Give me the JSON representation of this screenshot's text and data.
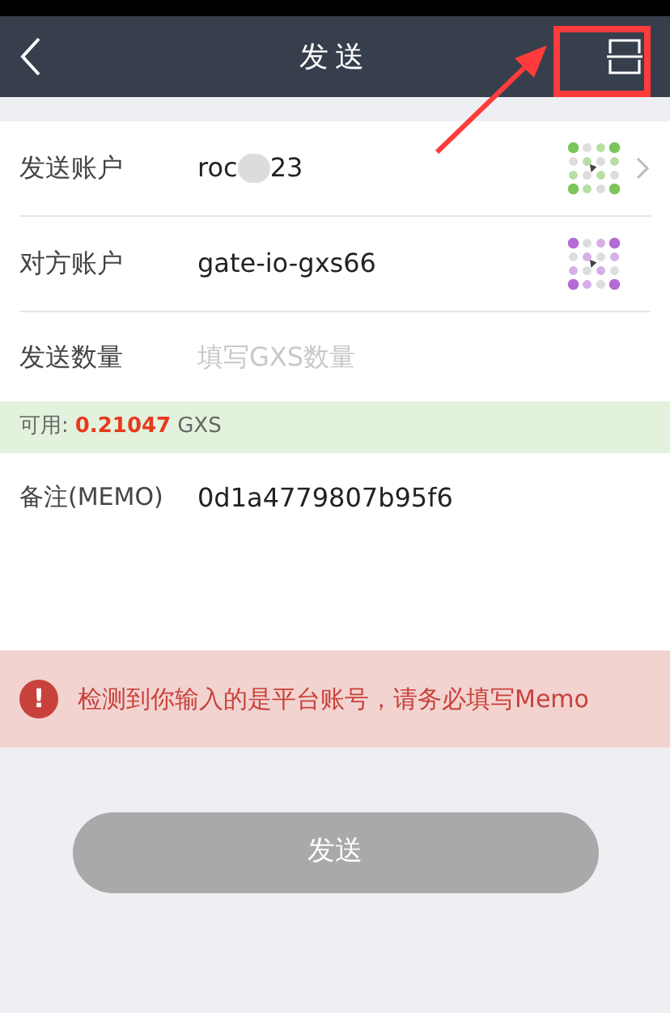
{
  "header": {
    "title": "发送"
  },
  "fields": [
    {
      "kind": "account",
      "label": "发送账户",
      "value_start": "roc",
      "value_end": "23",
      "redacted": true,
      "color": "#7cc55a",
      "chevron": true
    },
    {
      "kind": "account",
      "label": "对方账户",
      "value_start": "gate-io-gxs66",
      "redacted": false,
      "color": "#b56bd6",
      "chevron": false
    },
    {
      "kind": "input",
      "label": "发送数量",
      "placeholder": "填写GXS数量"
    }
  ],
  "available": {
    "label": "可用:",
    "amount": "0.21047",
    "unit": "GXS"
  },
  "memo": {
    "label": "备注(MEMO)",
    "value": "0d1a4779807b95f6"
  },
  "warning": {
    "icon": "!",
    "text": "检测到你输入的是平台账号，请务必填写Memo"
  },
  "submit": {
    "label": "发送",
    "disabled": true
  }
}
